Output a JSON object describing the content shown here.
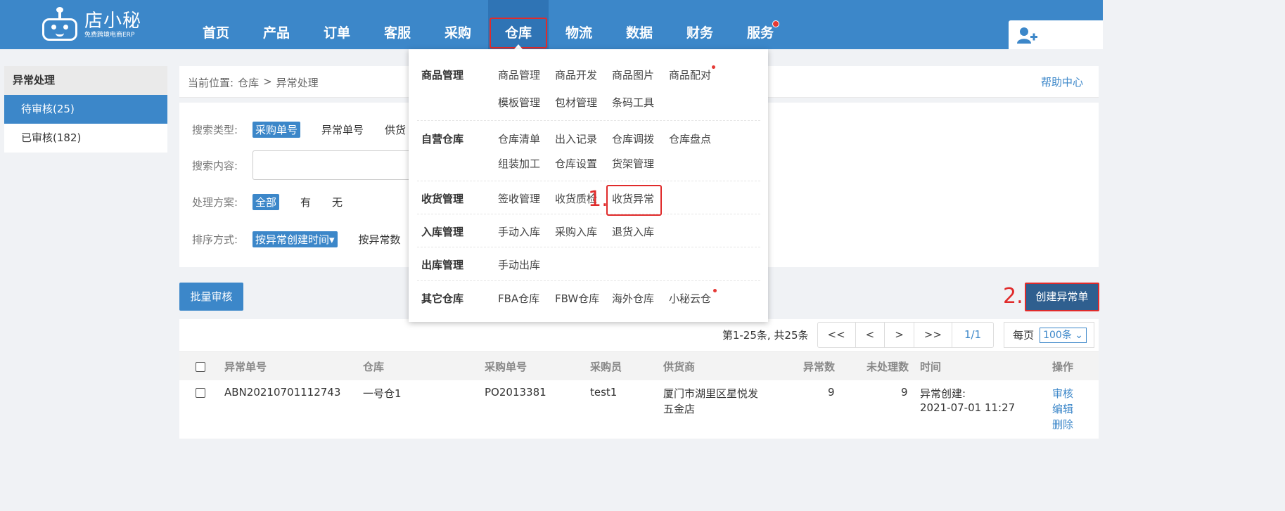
{
  "logo": {
    "title": "店小秘",
    "subtitle": "免费跨境电商ERP"
  },
  "nav": {
    "items": [
      {
        "label": "首页"
      },
      {
        "label": "产品"
      },
      {
        "label": "订单"
      },
      {
        "label": "客服"
      },
      {
        "label": "采购"
      },
      {
        "label": "仓库"
      },
      {
        "label": "物流"
      },
      {
        "label": "数据"
      },
      {
        "label": "财务"
      },
      {
        "label": "服务"
      }
    ],
    "active": "仓库"
  },
  "sidebar": {
    "title": "异常处理",
    "items": [
      {
        "label": "待审核(25)"
      },
      {
        "label": "已审核(182)"
      }
    ]
  },
  "breadcrumb": {
    "prefix": "当前位置:",
    "level1": "仓库",
    "sep": ">",
    "level2": "异常处理"
  },
  "help_link": "帮助中心",
  "search": {
    "type_label": "搜索类型:",
    "type_selected": "采购单号",
    "type_opt2": "异常单号",
    "type_opt3": "供货",
    "content_label": "搜索内容:",
    "plan_label": "处理方案:",
    "plan_selected": "全部",
    "plan_opt2": "有",
    "plan_opt3": "无",
    "sort_label": "排序方式:",
    "sort_selected": "按异常创建时间▾",
    "sort_opt2": "按异常数"
  },
  "buttons": {
    "batch_review": "批量审核",
    "create_exception": "创建异常单",
    "step2": "2."
  },
  "pager": {
    "info": "第1-25条, 共25条",
    "first": "<<",
    "prev": "<",
    "next": ">",
    "last": ">>",
    "page": "1/1",
    "per_page_label": "每页",
    "per_page_value": "100条 ⌄"
  },
  "table": {
    "headers": {
      "no": "异常单号",
      "warehouse": "仓库",
      "po": "采购单号",
      "buyer": "采购员",
      "supplier": "供货商",
      "count": "异常数",
      "unprocessed": "未处理数",
      "time": "时间",
      "ops": "操作"
    },
    "rows": [
      {
        "no": "ABN20210701112743",
        "warehouse": "一号仓1",
        "po": "PO2013381",
        "buyer": "test1",
        "supplier_l1": "厦门市湖里区星悦发",
        "supplier_l2": "五金店",
        "count": "9",
        "unprocessed": "9",
        "time_l1": "异常创建:",
        "time_l2": "2021-07-01 11:27",
        "op1": "审核",
        "op2": "编辑",
        "op3": "删除"
      }
    ]
  },
  "dropdown": {
    "groups": [
      {
        "title": "商品管理",
        "items": [
          "商品管理",
          "商品开发",
          "商品图片",
          "商品配对",
          "模板管理",
          "包材管理",
          "条码工具"
        ]
      },
      {
        "title": "自营仓库",
        "items": [
          "仓库清单",
          "出入记录",
          "仓库调拨",
          "仓库盘点",
          "组装加工",
          "仓库设置",
          "货架管理"
        ]
      },
      {
        "title": "收货管理",
        "items": [
          "签收管理",
          "收货质检",
          "收货异常"
        ]
      },
      {
        "title": "入库管理",
        "items": [
          "手动入库",
          "采购入库",
          "退货入库"
        ]
      },
      {
        "title": "出库管理",
        "items": [
          "手动出库"
        ]
      },
      {
        "title": "其它仓库",
        "items": [
          "FBA仓库",
          "FBW仓库",
          "海外仓库",
          "小秘云仓"
        ]
      }
    ],
    "step1": "1."
  },
  "colors": {
    "primary": "#3c87c9",
    "highlight": "#e02b2b",
    "badge": "#e53935"
  }
}
